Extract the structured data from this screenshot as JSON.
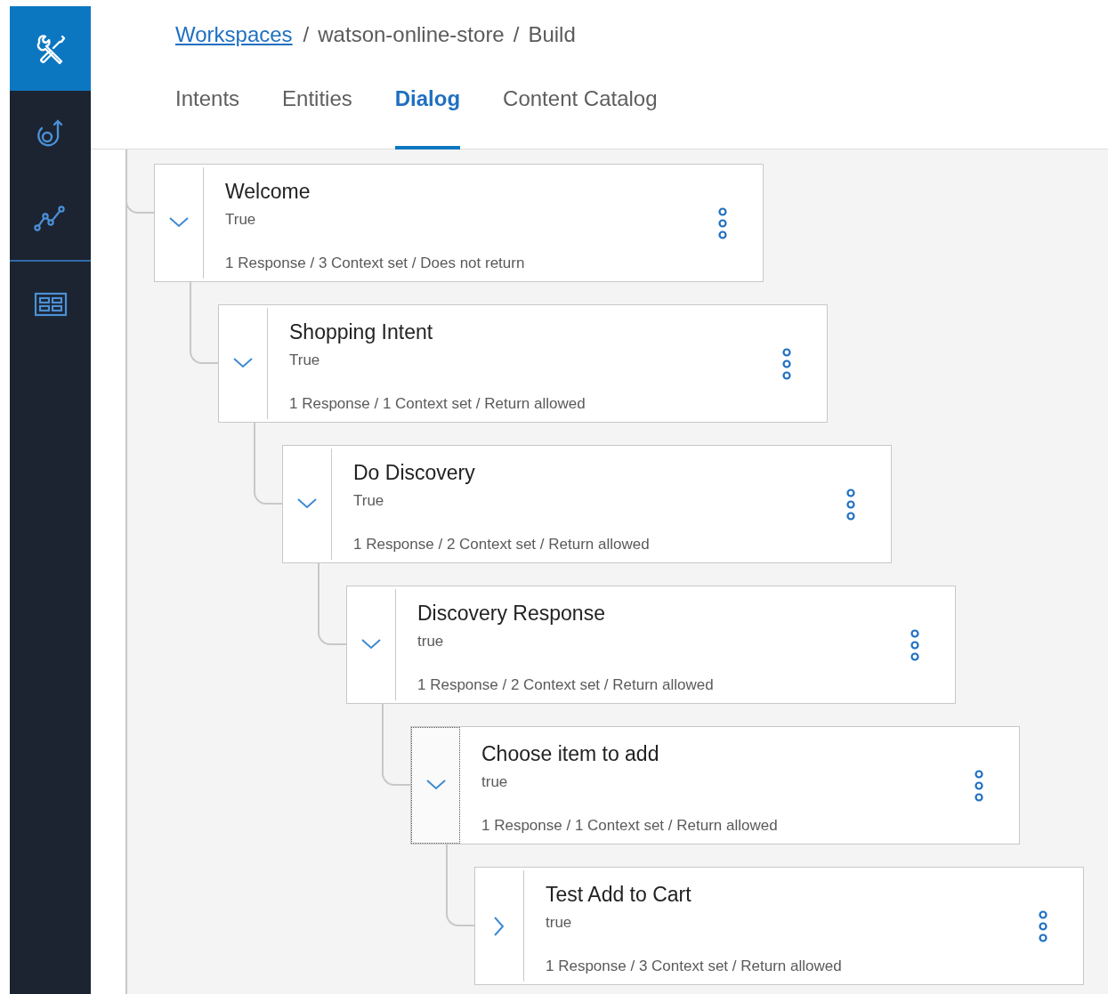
{
  "sidebar": {
    "groups": [
      [
        {
          "kind": "tools",
          "selected": true
        },
        {
          "kind": "deploy",
          "selected": false
        },
        {
          "kind": "analytics",
          "selected": false
        }
      ],
      [
        {
          "kind": "catalog",
          "selected": false
        }
      ]
    ]
  },
  "breadcrumb": {
    "separator": "/",
    "items": [
      {
        "label": "Workspaces",
        "kind": "link"
      },
      {
        "label": "watson-online-store",
        "kind": "text"
      },
      {
        "label": "Build",
        "kind": "text"
      }
    ]
  },
  "tabs": [
    {
      "label": "Intents",
      "selected": false
    },
    {
      "label": "Entities",
      "selected": false
    },
    {
      "label": "Dialog",
      "selected": true
    },
    {
      "label": "Content Catalog",
      "selected": false
    }
  ],
  "dialog_nodes": [
    {
      "title": "Welcome",
      "condition": "True",
      "summary": "1 Response / 3 Context set / Does not return",
      "expanded": true,
      "focused": false,
      "children": [
        {
          "title": "Shopping Intent",
          "condition": "True",
          "summary": "1 Response / 1 Context set / Return allowed",
          "expanded": true,
          "focused": false,
          "children": [
            {
              "title": "Do Discovery",
              "condition": "True",
              "summary": "1 Response / 2 Context set / Return allowed",
              "expanded": true,
              "focused": false,
              "children": [
                {
                  "title": "Discovery Response",
                  "condition": "true",
                  "summary": "1 Response / 2 Context set / Return allowed",
                  "expanded": true,
                  "focused": false,
                  "children": [
                    {
                      "title": "Choose item to add",
                      "condition": "true",
                      "summary": "1 Response / 1 Context set / Return allowed",
                      "expanded": true,
                      "focused": true,
                      "children": [
                        {
                          "title": "Test Add to Cart",
                          "condition": "true",
                          "summary": "1 Response / 3 Context set / Return allowed",
                          "expanded": false,
                          "focused": false
                        }
                      ]
                    }
                  ]
                }
              ]
            }
          ]
        }
      ]
    }
  ]
}
